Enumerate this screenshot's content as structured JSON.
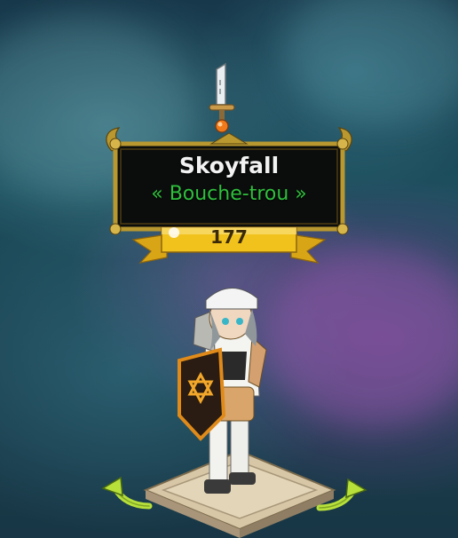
{
  "character": {
    "name": "Skoyfall",
    "title": "« Bouche-trou »",
    "level": "177"
  },
  "icons": {
    "weapon": "sword-icon",
    "rotate_left": "rotate-left-arrow-icon",
    "rotate_right": "rotate-right-arrow-icon",
    "shield_emblem": "hexagram-star-icon"
  },
  "colors": {
    "name_text": "#f2f2f2",
    "title_text": "#2fbf3c",
    "level_ribbon": "#f2c21c",
    "frame_gold": "#b9982f",
    "plate_bg": "#0b0d0d",
    "arrow_green": "#b7e03a"
  }
}
